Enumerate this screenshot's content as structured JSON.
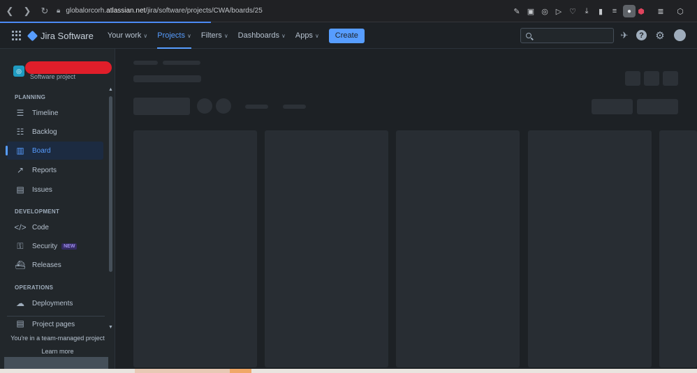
{
  "browser": {
    "url_prefix": "globalorcorh.",
    "url_host": "atlassian.net",
    "url_path": "/jira/software/projects/CWA/boards/25",
    "back_icon": "arrow-left-icon",
    "forward_icon": "arrow-right-icon",
    "reload_icon": "reload-icon"
  },
  "topnav": {
    "logo_text": "Jira Software",
    "your_work": "Your work",
    "projects": "Projects",
    "filters": "Filters",
    "dashboards": "Dashboards",
    "apps": "Apps",
    "create": "Create",
    "search_placeholder": ""
  },
  "sidebar": {
    "project_type": "Software project",
    "planning_title": "PLANNING",
    "timeline": "Timeline",
    "backlog": "Backlog",
    "board": "Board",
    "reports": "Reports",
    "issues": "Issues",
    "development_title": "DEVELOPMENT",
    "code": "Code",
    "security": "Security",
    "security_badge": "NEW",
    "releases": "Releases",
    "operations_title": "OPERATIONS",
    "deployments": "Deployments",
    "project_pages": "Project pages",
    "team_note": "You're in a team-managed project",
    "learn_more": "Learn more"
  },
  "colors": {
    "accent": "#579dff",
    "background": "#1d2125",
    "sidebar": "#22272b",
    "redaction": "#e01e2a"
  }
}
